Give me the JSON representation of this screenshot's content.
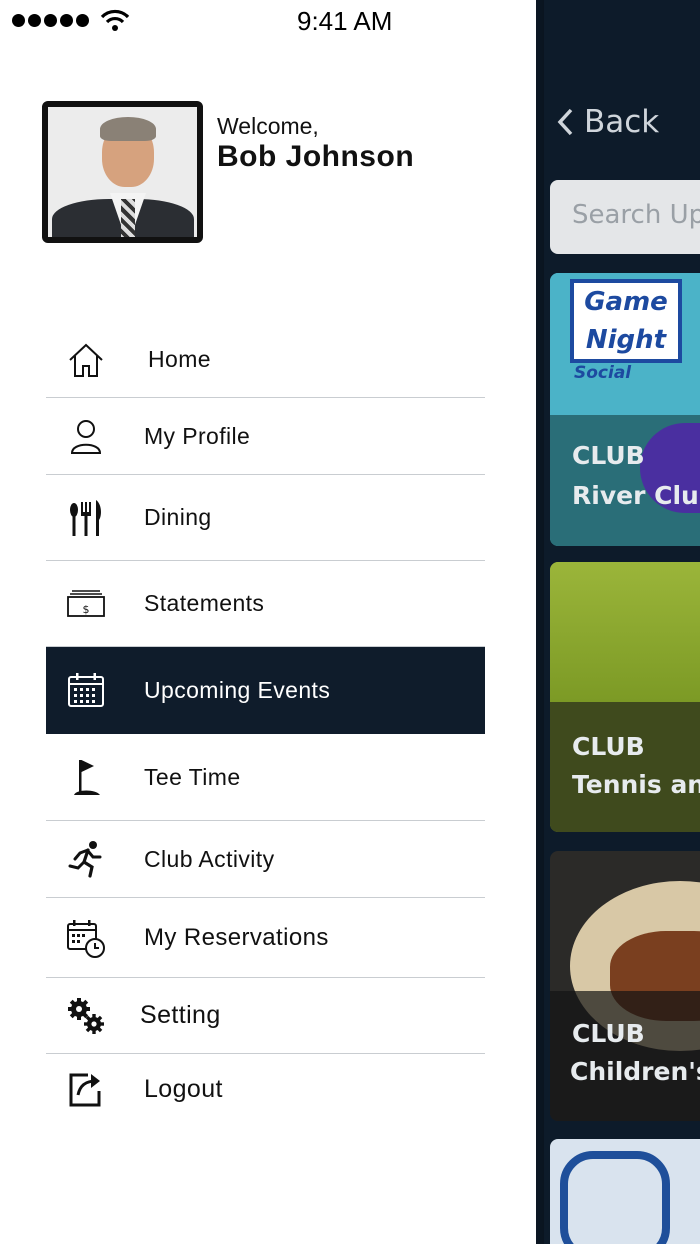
{
  "status_bar": {
    "time": "9:41 AM"
  },
  "background_page": {
    "back_label": "Back",
    "search_placeholder": "Search Up",
    "cards": [
      {
        "club": "CLUB",
        "title": "River Club ",
        "poster_line1": "Game",
        "poster_line2": "Night",
        "poster_line3": "Social"
      },
      {
        "club": "CLUB",
        "title": "Tennis and"
      },
      {
        "club": "CLUB",
        "title": "Children's"
      }
    ]
  },
  "drawer": {
    "welcome": "Welcome,",
    "user_name": "Bob Johnson",
    "menu": [
      {
        "label": "Home",
        "icon": "home-icon"
      },
      {
        "label": "My Profile",
        "icon": "user-icon"
      },
      {
        "label": "Dining",
        "icon": "utensils-icon"
      },
      {
        "label": "Statements",
        "icon": "money-icon"
      },
      {
        "label": "Upcoming Events",
        "icon": "calendar-icon",
        "active": true
      },
      {
        "label": "Tee Time",
        "icon": "golf-flag-icon"
      },
      {
        "label": "Club Activity",
        "icon": "running-icon"
      },
      {
        "label": "My Reservations",
        "icon": "calendar-clock-icon"
      },
      {
        "label": "Setting",
        "icon": "gears-icon"
      },
      {
        "label": "Logout",
        "icon": "logout-icon"
      }
    ]
  },
  "colors": {
    "active_bg": "#0f1c2b",
    "page_bg": "#0d1b2a",
    "divider": "#c9cdd1"
  }
}
